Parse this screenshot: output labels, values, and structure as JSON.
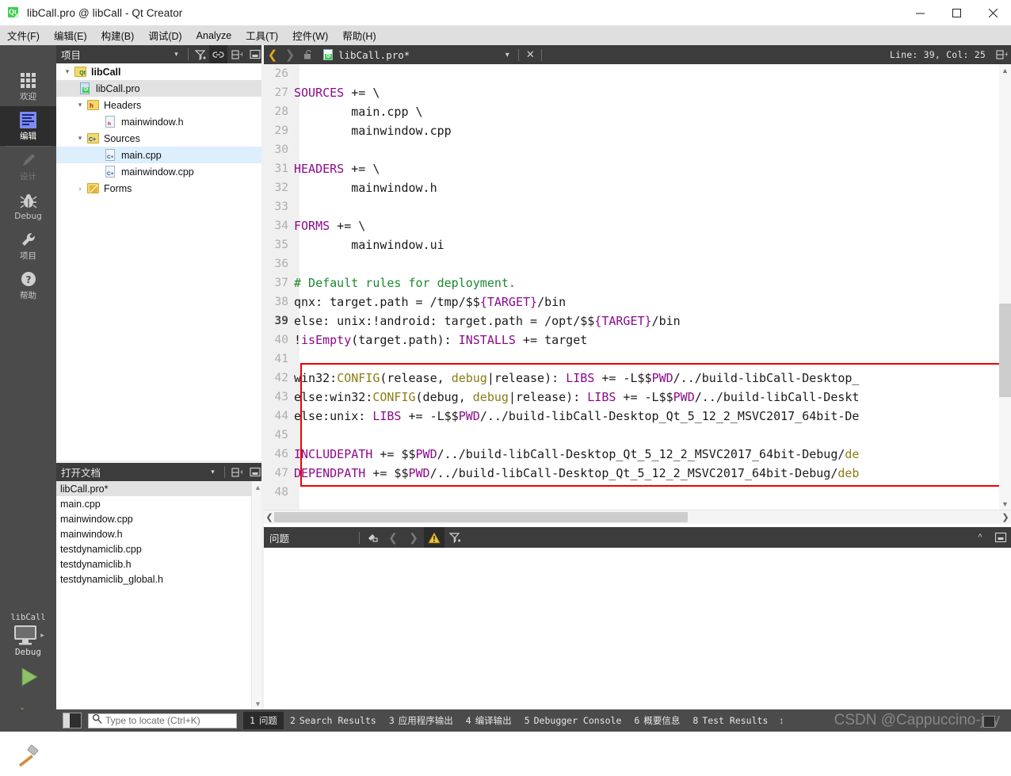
{
  "window": {
    "title": "libCall.pro @ libCall - Qt Creator",
    "app_icon": "qt-logo-icon",
    "minimize_label": "─",
    "maximize_label": "□",
    "close_label": "✕"
  },
  "menubar": {
    "items": [
      {
        "label": "文件(F)"
      },
      {
        "label": "编辑(E)"
      },
      {
        "label": "构建(B)"
      },
      {
        "label": "调试(D)"
      },
      {
        "label": "Analyze"
      },
      {
        "label": "工具(T)"
      },
      {
        "label": "控件(W)"
      },
      {
        "label": "帮助(H)"
      }
    ]
  },
  "modebar": {
    "items": [
      {
        "label": "欢迎",
        "icon": "grid-icon",
        "state": "normal"
      },
      {
        "label": "编辑",
        "icon": "document-edit-icon",
        "state": "active"
      },
      {
        "label": "设计",
        "icon": "pencil-icon",
        "state": "disabled"
      },
      {
        "label": "Debug",
        "icon": "bug-icon",
        "state": "normal"
      },
      {
        "label": "项目",
        "icon": "wrench-icon",
        "state": "normal"
      },
      {
        "label": "帮助",
        "icon": "question-circle-icon",
        "state": "normal"
      }
    ],
    "kit": {
      "project_name": "libCall",
      "build_config": "Debug",
      "target_icon": "monitor-icon",
      "run_icon": "play-icon",
      "debug_icon": "play-bug-icon",
      "build_icon": "hammer-icon"
    }
  },
  "projects_panel": {
    "title": "项目",
    "toolbar": [
      {
        "name": "filter-dropdown-icon",
        "glyph": "▾"
      },
      {
        "name": "filter-icon",
        "glyph": "filter"
      },
      {
        "name": "link-sync-icon",
        "glyph": "link",
        "active": true
      },
      {
        "name": "split-add-icon",
        "glyph": "split"
      },
      {
        "name": "collapse-panel-icon",
        "glyph": "minimize"
      }
    ],
    "tree": [
      {
        "label": "libCall",
        "depth": 0,
        "expander": "⌄",
        "icon": "project-folder-icon",
        "bold": true,
        "selected": false
      },
      {
        "label": "libCall.pro",
        "depth": 1,
        "expander": "",
        "icon": "pro-file-icon",
        "bold": false,
        "selected": true
      },
      {
        "label": "Headers",
        "depth": 1,
        "expander": "⌄",
        "icon": "headers-folder-icon",
        "bold": false,
        "selected": false
      },
      {
        "label": "mainwindow.h",
        "depth": 2,
        "expander": "",
        "icon": "h-file-icon",
        "bold": false,
        "selected": false
      },
      {
        "label": "Sources",
        "depth": 1,
        "expander": "⌄",
        "icon": "sources-folder-icon",
        "bold": false,
        "selected": false
      },
      {
        "label": "main.cpp",
        "depth": 2,
        "expander": "",
        "icon": "cpp-file-icon",
        "bold": false,
        "selected": "blue"
      },
      {
        "label": "mainwindow.cpp",
        "depth": 2,
        "expander": "",
        "icon": "cpp-file-icon",
        "bold": false,
        "selected": false
      },
      {
        "label": "Forms",
        "depth": 1,
        "expander": "›",
        "icon": "forms-folder-icon",
        "bold": false,
        "selected": false
      }
    ]
  },
  "open_documents_panel": {
    "title": "打开文档",
    "toolbar": [
      {
        "name": "documents-dropdown-icon",
        "glyph": "▾"
      },
      {
        "name": "split-add-icon",
        "glyph": "split"
      },
      {
        "name": "collapse-panel-icon",
        "glyph": "minimize"
      }
    ],
    "documents": [
      {
        "label": "libCall.pro*",
        "selected": true
      },
      {
        "label": "main.cpp",
        "selected": false
      },
      {
        "label": "mainwindow.cpp",
        "selected": false
      },
      {
        "label": "mainwindow.h",
        "selected": false
      },
      {
        "label": "testdynamiclib.cpp",
        "selected": false
      },
      {
        "label": "testdynamiclib.h",
        "selected": false
      },
      {
        "label": "testdynamiclib_global.h",
        "selected": false
      }
    ]
  },
  "editor": {
    "toolbar": {
      "back_icon": "chevron-left-icon",
      "forward_icon": "chevron-right-icon",
      "lock_icon": "unlocked-padlock-icon",
      "file_icon": "pro-file-icon",
      "filename": "libCall.pro*",
      "dropdown_icon": "▾",
      "close_icon": "✕",
      "cursor_position": "Line: 39, Col: 25",
      "split_icon": "split-editor-icon"
    },
    "current_line": 39,
    "lines": [
      {
        "no": "26",
        "tokens": [
          {
            "t": "",
            "c": "plain"
          }
        ]
      },
      {
        "no": "27",
        "tokens": [
          {
            "t": "SOURCES",
            "c": "kw"
          },
          {
            "t": " += \\",
            "c": "plain"
          }
        ]
      },
      {
        "no": "28",
        "tokens": [
          {
            "t": "        main.cpp \\",
            "c": "plain"
          }
        ]
      },
      {
        "no": "29",
        "tokens": [
          {
            "t": "        mainwindow.cpp",
            "c": "plain"
          }
        ]
      },
      {
        "no": "30",
        "tokens": [
          {
            "t": "",
            "c": "plain"
          }
        ]
      },
      {
        "no": "31",
        "tokens": [
          {
            "t": "HEADERS",
            "c": "kw"
          },
          {
            "t": " += \\",
            "c": "plain"
          }
        ]
      },
      {
        "no": "32",
        "tokens": [
          {
            "t": "        mainwindow.h",
            "c": "plain"
          }
        ]
      },
      {
        "no": "33",
        "tokens": [
          {
            "t": "",
            "c": "plain"
          }
        ]
      },
      {
        "no": "34",
        "tokens": [
          {
            "t": "FORMS",
            "c": "kw"
          },
          {
            "t": " += \\",
            "c": "plain"
          }
        ]
      },
      {
        "no": "35",
        "tokens": [
          {
            "t": "        mainwindow.ui",
            "c": "plain"
          }
        ]
      },
      {
        "no": "36",
        "tokens": [
          {
            "t": "",
            "c": "plain"
          }
        ]
      },
      {
        "no": "37",
        "tokens": [
          {
            "t": "# Default rules for deployment.",
            "c": "cm"
          }
        ]
      },
      {
        "no": "38",
        "tokens": [
          {
            "t": "qnx: target.path = /tmp/$$",
            "c": "plain"
          },
          {
            "t": "{TARGET}",
            "c": "kw"
          },
          {
            "t": "/bin",
            "c": "plain"
          }
        ]
      },
      {
        "no": "39",
        "tokens": [
          {
            "t": "else: unix:!android: target.path = /opt/$$",
            "c": "plain"
          },
          {
            "t": "{TARGET}",
            "c": "kw"
          },
          {
            "t": "/bin",
            "c": "plain"
          }
        ]
      },
      {
        "no": "40",
        "tokens": [
          {
            "t": "!",
            "c": "plain"
          },
          {
            "t": "isEmpty",
            "c": "kw"
          },
          {
            "t": "(target.path): ",
            "c": "plain"
          },
          {
            "t": "INSTALLS",
            "c": "kw"
          },
          {
            "t": " += target",
            "c": "plain"
          }
        ]
      },
      {
        "no": "41",
        "tokens": [
          {
            "t": "",
            "c": "plain"
          }
        ]
      },
      {
        "no": "42",
        "tokens": [
          {
            "t": "win32:",
            "c": "plain"
          },
          {
            "t": "CONFIG",
            "c": "cfg"
          },
          {
            "t": "(release, ",
            "c": "plain"
          },
          {
            "t": "debug",
            "c": "cfg"
          },
          {
            "t": "|release): ",
            "c": "plain"
          },
          {
            "t": "LIBS",
            "c": "kw"
          },
          {
            "t": " += -L$$",
            "c": "plain"
          },
          {
            "t": "PWD",
            "c": "kw"
          },
          {
            "t": "/../build-libCall-Desktop_",
            "c": "plain"
          }
        ]
      },
      {
        "no": "43",
        "tokens": [
          {
            "t": "else:win32:",
            "c": "plain"
          },
          {
            "t": "CONFIG",
            "c": "cfg"
          },
          {
            "t": "(debug, ",
            "c": "plain"
          },
          {
            "t": "debug",
            "c": "cfg"
          },
          {
            "t": "|release): ",
            "c": "plain"
          },
          {
            "t": "LIBS",
            "c": "kw"
          },
          {
            "t": " += -L$$",
            "c": "plain"
          },
          {
            "t": "PWD",
            "c": "kw"
          },
          {
            "t": "/../build-libCall-Deskt",
            "c": "plain"
          }
        ]
      },
      {
        "no": "44",
        "tokens": [
          {
            "t": "else:unix: ",
            "c": "plain"
          },
          {
            "t": "LIBS",
            "c": "kw"
          },
          {
            "t": " += -L$$",
            "c": "plain"
          },
          {
            "t": "PWD",
            "c": "kw"
          },
          {
            "t": "/../build-libCall-Desktop_Qt_5_12_2_MSVC2017_64bit-De",
            "c": "plain"
          }
        ]
      },
      {
        "no": "45",
        "tokens": [
          {
            "t": "",
            "c": "plain"
          }
        ]
      },
      {
        "no": "46",
        "tokens": [
          {
            "t": "INCLUDEPATH",
            "c": "kw"
          },
          {
            "t": " += $$",
            "c": "plain"
          },
          {
            "t": "PWD",
            "c": "kw"
          },
          {
            "t": "/../build-libCall-Desktop_Qt_5_12_2_MSVC2017_64bit-Debug/",
            "c": "plain"
          },
          {
            "t": "de",
            "c": "cfg"
          }
        ]
      },
      {
        "no": "47",
        "tokens": [
          {
            "t": "DEPENDPATH",
            "c": "kw"
          },
          {
            "t": " += $$",
            "c": "plain"
          },
          {
            "t": "PWD",
            "c": "kw"
          },
          {
            "t": "/../build-libCall-Desktop_Qt_5_12_2_MSVC2017_64bit-Debug/",
            "c": "plain"
          },
          {
            "t": "deb",
            "c": "cfg"
          }
        ]
      },
      {
        "no": "48",
        "tokens": [
          {
            "t": "",
            "c": "plain"
          }
        ]
      }
    ],
    "annotation": {
      "name": "red-highlight-box",
      "color": "#ef0000"
    }
  },
  "output_pane": {
    "title": "问题",
    "toolbar": [
      {
        "name": "clear-issues-icon",
        "glyph": "broom"
      },
      {
        "name": "previous-issue-icon",
        "glyph": "‹"
      },
      {
        "name": "next-issue-icon",
        "glyph": "›"
      },
      {
        "name": "warning-filter-icon",
        "glyph": "warning",
        "active": true
      },
      {
        "name": "filter-icon",
        "glyph": "filter"
      }
    ],
    "right_buttons": [
      {
        "name": "maximize-pane-icon",
        "glyph": "˄"
      },
      {
        "name": "close-pane-icon",
        "glyph": "minimize"
      }
    ],
    "rows": []
  },
  "statusbar": {
    "sidebar_toggle_icon": "sidebar-toggle-icon",
    "locator": {
      "icon": "search-icon",
      "placeholder": "Type to locate (Ctrl+K)",
      "value": ""
    },
    "tabs": [
      {
        "num": "1",
        "label": "问题",
        "active": true
      },
      {
        "num": "2",
        "label": "Search Results",
        "active": false
      },
      {
        "num": "3",
        "label": "应用程序输出",
        "active": false
      },
      {
        "num": "4",
        "label": "编译输出",
        "active": false
      },
      {
        "num": "5",
        "label": "Debugger Console",
        "active": false
      },
      {
        "num": "6",
        "label": "概要信息",
        "active": false
      },
      {
        "num": "8",
        "label": "Test Results",
        "active": false
      }
    ],
    "updown_icon": "⇅",
    "watermark": "CSDN @Cappuccino-jay"
  },
  "colors": {
    "keyword": "#8b0a8b",
    "comment": "#1a8a2e",
    "config": "#8a7d15",
    "annotation": "#ef0000",
    "panel_header": "#3c3c3c",
    "modebar": "#4b4b4b",
    "selection": "#e2e2e2"
  }
}
